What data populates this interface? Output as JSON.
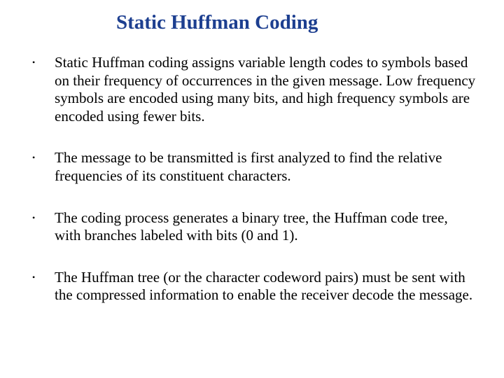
{
  "title": "Static Huffman Coding",
  "bullets": [
    "Static Huffman coding assigns variable length codes to symbols based on their frequency of occurrences in the given message. Low frequency symbols are encoded using many bits, and high frequency symbols are encoded using fewer bits.",
    "The message to be transmitted is first analyzed to find the relative frequencies of its constituent characters.",
    "The coding process generates a binary tree, the Huffman code tree, with branches labeled with bits (0 and 1).",
    "The Huffman tree (or the character codeword pairs) must be sent with the compressed information to enable the receiver decode the message."
  ]
}
